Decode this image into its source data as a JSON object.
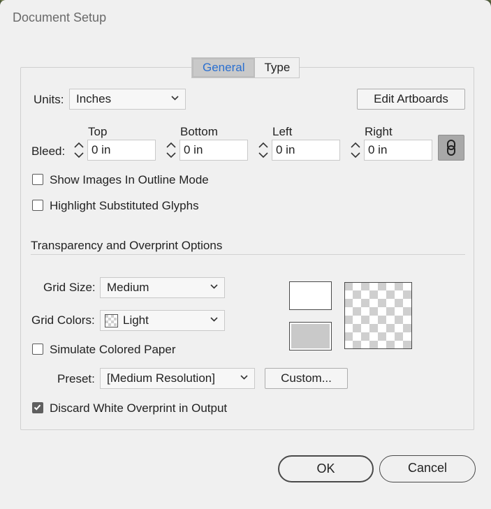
{
  "window": {
    "title": "Document Setup"
  },
  "tabs": [
    {
      "label": "General",
      "active": true
    },
    {
      "label": "Type",
      "active": false
    }
  ],
  "general": {
    "units_label": "Units:",
    "units_value": "Inches",
    "edit_artboards_label": "Edit Artboards",
    "bleed_label": "Bleed:",
    "bleed": {
      "top_label": "Top",
      "top_value": "0 in",
      "bottom_label": "Bottom",
      "bottom_value": "0 in",
      "left_label": "Left",
      "left_value": "0 in",
      "right_label": "Right",
      "right_value": "0 in"
    },
    "show_images_outline": {
      "label": "Show Images In Outline Mode",
      "checked": false
    },
    "highlight_glyphs": {
      "label": "Highlight Substituted Glyphs",
      "checked": false
    }
  },
  "transparency": {
    "section_title": "Transparency and Overprint Options",
    "grid_size_label": "Grid Size:",
    "grid_size_value": "Medium",
    "grid_colors_label": "Grid Colors:",
    "grid_colors_value": "Light",
    "simulate_paper": {
      "label": "Simulate Colored Paper",
      "checked": false
    },
    "preset_label": "Preset:",
    "preset_value": "[Medium Resolution]",
    "custom_label": "Custom...",
    "discard_white": {
      "label": "Discard White Overprint in Output",
      "checked": true
    }
  },
  "footer": {
    "ok_label": "OK",
    "cancel_label": "Cancel"
  },
  "colors": {
    "accent": "#2a6fd0",
    "dialog_bg": "#f0f0f0"
  }
}
